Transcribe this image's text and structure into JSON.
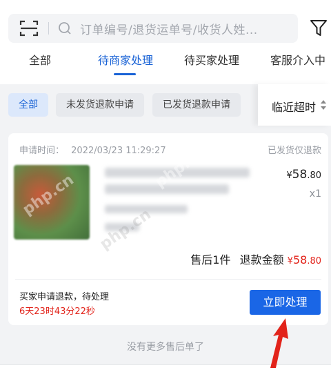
{
  "search": {
    "placeholder": "订单编号/退货运单号/收货人姓..."
  },
  "tabs": [
    {
      "label": "全部"
    },
    {
      "label": "待商家处理"
    },
    {
      "label": "待买家处理"
    },
    {
      "label": "客服介入中"
    }
  ],
  "chips": [
    {
      "label": "全部"
    },
    {
      "label": "未发货退款申请"
    },
    {
      "label": "已发货退款申请"
    }
  ],
  "sort": {
    "label": "临近超时"
  },
  "order": {
    "time_label": "申请时间：",
    "time_value": "2022/03/23 11:29:27",
    "status": "已发货仅退款",
    "price_symbol": "¥",
    "price_int": "58",
    "price_dec": ".80",
    "qty": "x1",
    "after_sale_count": "售后1件",
    "refund_label": "退款金额",
    "refund_symbol": "¥",
    "refund_int": "58",
    "refund_dec": ".80",
    "note": "买家申请退款，待处理",
    "countdown": "6天23时43分22秒",
    "action_label": "立即处理"
  },
  "footer": {
    "text": "没有更多售后单了"
  },
  "watermark": {
    "text": "php.cn"
  },
  "colors": {
    "accent": "#1a63d6",
    "button": "#1a66e6",
    "red": "#e2231a",
    "annotation_arrow": "#e2231a"
  }
}
